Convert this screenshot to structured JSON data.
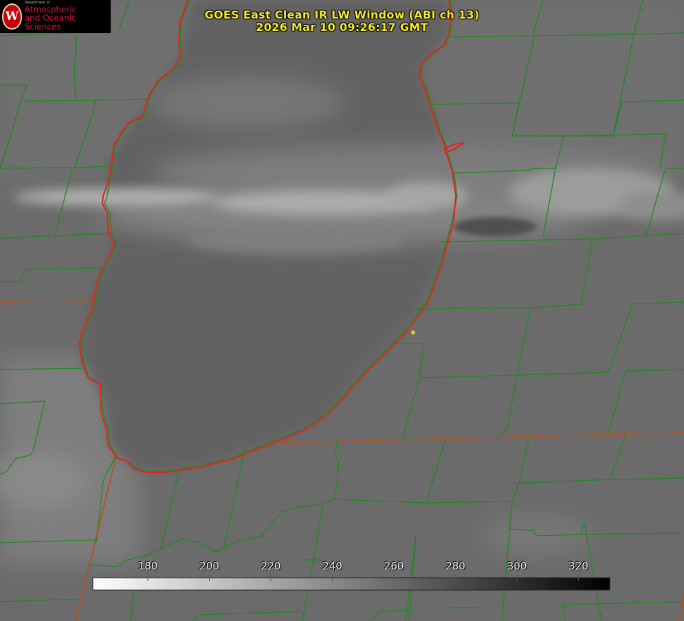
{
  "title": {
    "line1": "GOES East Clean IR LW Window (ABI ch 13)",
    "line2": "2026 Mar 10 09:26:17 GMT"
  },
  "logo": {
    "seal_letter": "W",
    "department": "Department of",
    "line1": "Atmospheric",
    "line2": "and Oceanic Sciences"
  },
  "colors": {
    "county_lines": "#1e8a1e",
    "state_lines": "#b4501e",
    "lake_shore": "#e82020",
    "title_text": "#f2ea2a",
    "marker": "#d9d020"
  },
  "colorbar": {
    "ticks": [
      "180",
      "200",
      "220",
      "240",
      "260",
      "280",
      "300",
      "320"
    ],
    "gradient": "white-to-black"
  }
}
